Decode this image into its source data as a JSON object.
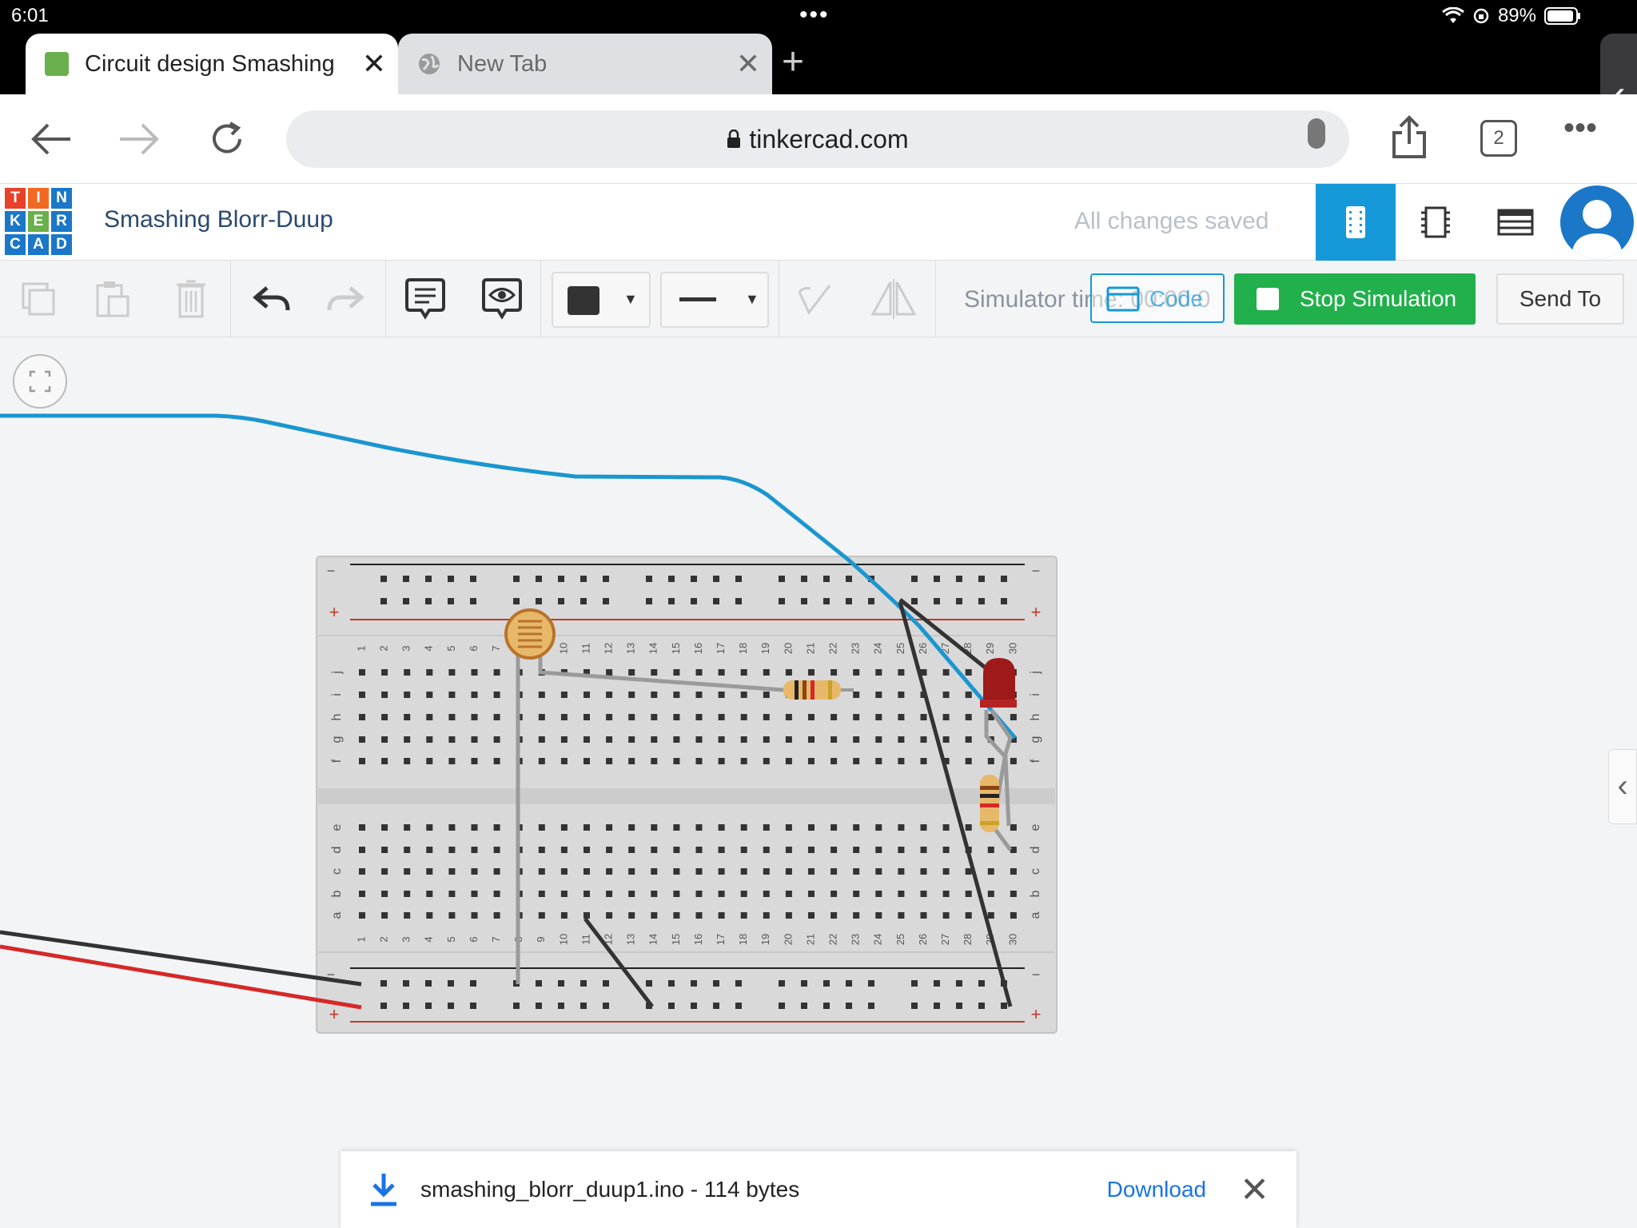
{
  "status_bar": {
    "time": "6:01",
    "dots": "•••",
    "battery": "89%"
  },
  "tabs": [
    {
      "title": "Circuit design Smashing",
      "active": true
    },
    {
      "title": "New Tab",
      "active": false
    }
  ],
  "address": {
    "url": "tinkercad.com"
  },
  "tab_count": "2",
  "header": {
    "logo_letters": [
      "T",
      "I",
      "N",
      "K",
      "E",
      "R",
      "C",
      "A",
      "D"
    ],
    "logo_colors": [
      "#e8412a",
      "#1b77c7",
      "#1b77c7",
      "#1b77c7",
      "#f26a22",
      "#1b77c7",
      "#1b77c7",
      "#1b77c7",
      "#1b77c7"
    ],
    "project_title": "Smashing Blorr-Duup",
    "save_status": "All changes saved"
  },
  "toolbar": {
    "simulator_time": "Simulator time: 00:00:0",
    "code_label": "Code",
    "stop_label": "Stop Simulation",
    "send_to_label": "Send To"
  },
  "breadboard": {
    "columns": [
      "1",
      "2",
      "3",
      "4",
      "5",
      "6",
      "7",
      "8",
      "9",
      "10",
      "11",
      "12",
      "13",
      "14",
      "15",
      "16",
      "17",
      "18",
      "19",
      "20",
      "21",
      "22",
      "23",
      "24",
      "25",
      "26",
      "27",
      "28",
      "29",
      "30"
    ],
    "top_rows": [
      "j",
      "i",
      "h",
      "g",
      "f"
    ],
    "bottom_rows": [
      "e",
      "d",
      "c",
      "b",
      "a"
    ],
    "rail_minus": "−",
    "rail_plus": "+"
  },
  "download": {
    "filename": "smashing_blorr_duup1.ino - 114 bytes",
    "action": "Download"
  },
  "colors": {
    "accent": "#1599d9",
    "stop_green": "#21b04b",
    "link_blue": "#1a73e8"
  }
}
